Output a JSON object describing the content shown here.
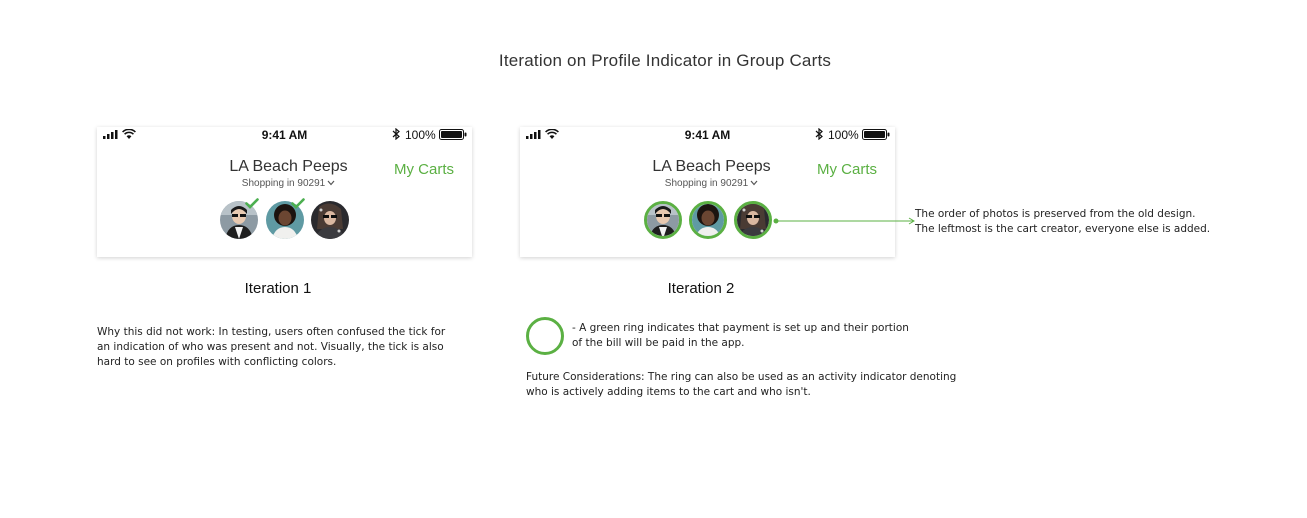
{
  "page": {
    "title": "Iteration on Profile Indicator in Group Carts"
  },
  "status_bar": {
    "time": "9:41 AM",
    "battery": "100%"
  },
  "header": {
    "group_name": "LA Beach Peeps",
    "location": "Shopping in 90291",
    "my_carts_label": "My Carts"
  },
  "iteration_1": {
    "label": "Iteration 1",
    "avatars": [
      {
        "name": "member-1",
        "ticked": true
      },
      {
        "name": "member-2",
        "ticked": true
      },
      {
        "name": "member-3",
        "ticked": false
      }
    ],
    "note": "Why this did not work: In testing, users often confused the tick for an indication of who was present and not. Visually, the tick is also hard to see on profiles with conflicting colors."
  },
  "iteration_2": {
    "label": "Iteration 2",
    "annotation_line_1": "The order of photos is preserved from the old design.",
    "annotation_line_2": "The leftmost is the cart creator, everyone else is added.",
    "legend_line_1": "- A green ring indicates that payment is set up and their portion",
    "legend_line_2": "of the bill will be paid in the app.",
    "future_line_1": "Future Considerations: The ring can also be used as an activity indicator denoting",
    "future_line_2": "who is actively adding items to the cart and who isn't."
  },
  "colors": {
    "accent_green": "#5bb043",
    "tick_green": "#4caf50"
  },
  "icons": [
    "signal-icon",
    "wifi-icon",
    "bluetooth-icon",
    "battery-icon",
    "chevron-down-icon",
    "tick-icon"
  ]
}
